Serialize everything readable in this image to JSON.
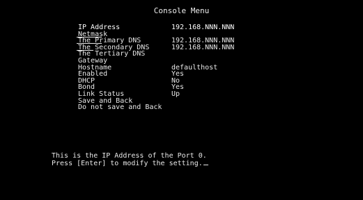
{
  "window": {
    "title": "Console Menu"
  },
  "menu": {
    "items": [
      {
        "label": "IP Address",
        "value": "192.168.NNN.NNN",
        "selected": true
      },
      {
        "label": "Netmask",
        "value": ""
      },
      {
        "label": "The Primary DNS",
        "value": "192.168.NNN.NNN"
      },
      {
        "label": "The Secondary DNS",
        "value": "192.168.NNN.NNN"
      },
      {
        "label": "The Tertiary DNS",
        "value": ""
      },
      {
        "label": "Gateway",
        "value": ""
      },
      {
        "label": "Hostname",
        "value": "defaulthost"
      },
      {
        "label": "Enabled",
        "value": "Yes"
      },
      {
        "label": "DHCP",
        "value": "No"
      },
      {
        "label": "Bond",
        "value": "Yes"
      },
      {
        "label": "Link Status",
        "value": "Up"
      },
      {
        "label": "Save and Back",
        "value": ""
      },
      {
        "label": "Do not save and Back",
        "value": ""
      }
    ]
  },
  "status": {
    "line1": "This is the IP Address of the Port 0.",
    "line2": "Press [Enter] to modify the setting."
  }
}
